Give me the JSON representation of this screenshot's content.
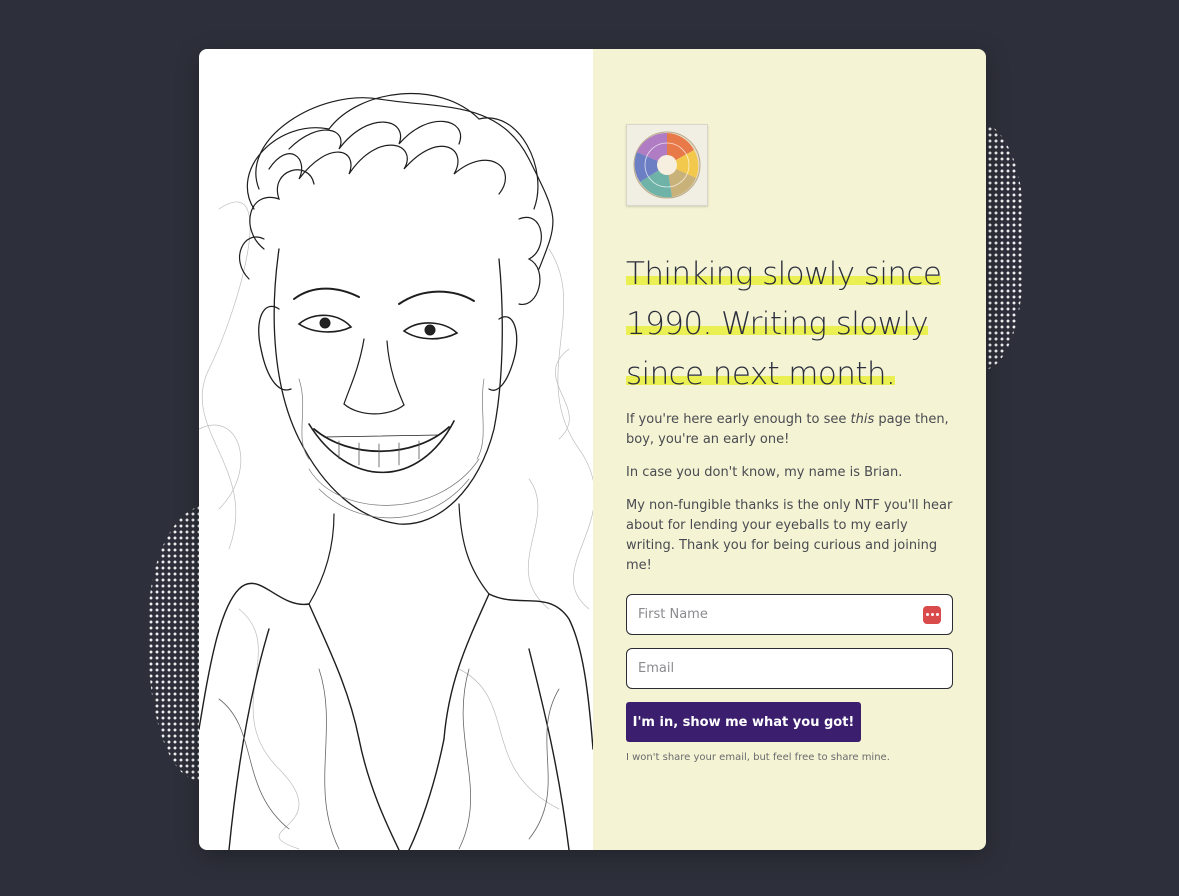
{
  "headline": {
    "line1": "Thinking slowly since",
    "line2": "1990. Writing slowly",
    "line3": "since next month."
  },
  "intro": {
    "p1_before": "If you're here early enough to see ",
    "p1_em": "this",
    "p1_after": " page then, boy, you're an early one!",
    "p2": "In case you don't know, my name is Brian.",
    "p3": "My non-fungible thanks is the only NTF you'll hear about for lending your eyeballs to my early writing. Thank you for being curious and joining me!"
  },
  "form": {
    "first_name_placeholder": "First Name",
    "email_placeholder": "Email",
    "submit_label": "I'm in, show me what you got!",
    "privacy_note": "I won't share your email, but feel free to share mine."
  },
  "icons": {
    "logo": "emotion-wheel-logo",
    "password_manager": "password-manager-icon"
  },
  "colors": {
    "page_background": "#2d2f3a",
    "panel_background": "#f4f3d3",
    "highlight": "#eaf052",
    "button": "#3b1e6e",
    "password_icon": "#d94a4a"
  }
}
